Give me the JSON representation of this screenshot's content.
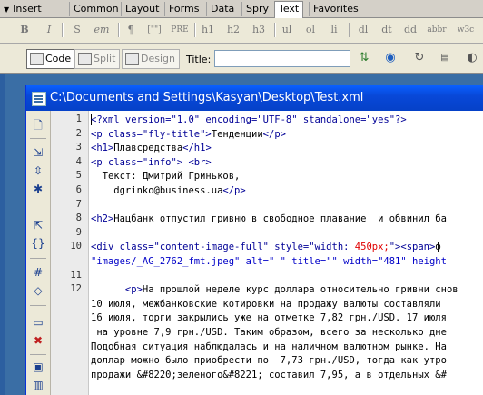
{
  "insert_bar": {
    "panel_label": "Insert",
    "tabs": [
      "Common",
      "Layout",
      "Forms",
      "Data",
      "Spry",
      "Text",
      "Favorites"
    ],
    "active_tab": "Text"
  },
  "text_toolbar": {
    "buttons": [
      "B",
      "I",
      "S",
      "em",
      "¶",
      "[\"\"]",
      "PRE",
      "h1",
      "h2",
      "h3",
      "ul",
      "ol",
      "li",
      "dl",
      "dt",
      "dd",
      "abbr",
      "w3c"
    ]
  },
  "doc_toolbar": {
    "code_label": "Code",
    "split_label": "Split",
    "design_label": "Design",
    "title_label": "Title:",
    "title_value": ""
  },
  "document_window": {
    "title": "C:\\Documents and Settings\\Kasyan\\Desktop\\Test.xml"
  },
  "line_numbers": [
    "1",
    "2",
    "3",
    "4",
    "5",
    "6",
    "7",
    "8",
    "9",
    "10",
    "",
    "11",
    "12",
    "",
    "",
    "",
    "",
    "",
    "",
    "",
    ""
  ],
  "code_lines": [
    {
      "parts": [
        {
          "c": "tag",
          "t": "<?xml version=\"1.0\" encoding=\"UTF-8\" standalone=\"yes\"?>"
        }
      ]
    },
    {
      "parts": [
        {
          "c": "tag",
          "t": "<p class=\"fly-title\">"
        },
        {
          "c": "txt",
          "t": "Тенденции"
        },
        {
          "c": "tag",
          "t": "</p>"
        }
      ]
    },
    {
      "parts": [
        {
          "c": "tag",
          "t": "<h1>"
        },
        {
          "c": "txt",
          "t": "Плавсредства"
        },
        {
          "c": "tag",
          "t": "</h1>"
        }
      ]
    },
    {
      "parts": [
        {
          "c": "tag",
          "t": "<p class=\"info\"> <br>"
        }
      ]
    },
    {
      "parts": [
        {
          "c": "txt",
          "t": "  Текст: Дмитрий Гриньков,"
        }
      ]
    },
    {
      "parts": [
        {
          "c": "txt",
          "t": "    dgrinko@business.ua"
        },
        {
          "c": "tag",
          "t": "</p>"
        }
      ]
    },
    {
      "parts": [
        {
          "c": "txt",
          "t": ""
        }
      ]
    },
    {
      "parts": [
        {
          "c": "tag",
          "t": "<h2>"
        },
        {
          "c": "txt",
          "t": "Нацбанк отпустил гривню в свободное плавание  и обвинил ба"
        }
      ]
    },
    {
      "parts": [
        {
          "c": "txt",
          "t": ""
        }
      ]
    },
    {
      "parts": [
        {
          "c": "tag",
          "t": "<div class=\"content-image-full\" style=\"width: "
        },
        {
          "c": "hl",
          "t": "450px;"
        },
        {
          "c": "tag",
          "t": "\"><span>"
        },
        {
          "c": "txt",
          "t": "ф"
        }
      ]
    },
    {
      "parts": [
        {
          "c": "val",
          "t": "\"images/_AG_2762_fmt.jpeg\" alt=\" \" title=\"\" width=\"481\" height"
        }
      ]
    },
    {
      "parts": [
        {
          "c": "txt",
          "t": ""
        }
      ]
    },
    {
      "parts": [
        {
          "c": "tag",
          "t": "      <p>"
        },
        {
          "c": "txt",
          "t": "На прошлой неделе курс доллара относительно гривни снов"
        }
      ]
    },
    {
      "parts": [
        {
          "c": "txt",
          "t": "10 июля, межбанковские котировки на продажу валюты составляли"
        }
      ]
    },
    {
      "parts": [
        {
          "c": "txt",
          "t": "16 июля, торги закрылись уже на отметке 7,82 грн./USD. 17 июля"
        }
      ]
    },
    {
      "parts": [
        {
          "c": "txt",
          "t": " на уровне 7,9 грн./USD. Таким образом, всего за несколько дне"
        }
      ]
    },
    {
      "parts": [
        {
          "c": "txt",
          "t": "Подобная ситуация наблюдалась и на наличном валютном рынке. На"
        }
      ]
    },
    {
      "parts": [
        {
          "c": "txt",
          "t": "доллар можно было приобрести по  7,73 грн./USD, тогда как утро"
        }
      ]
    },
    {
      "parts": [
        {
          "c": "txt",
          "t": "продажи &#8220;зеленого&#8221; составил 7,95, а в отдельных &#"
        }
      ]
    }
  ]
}
